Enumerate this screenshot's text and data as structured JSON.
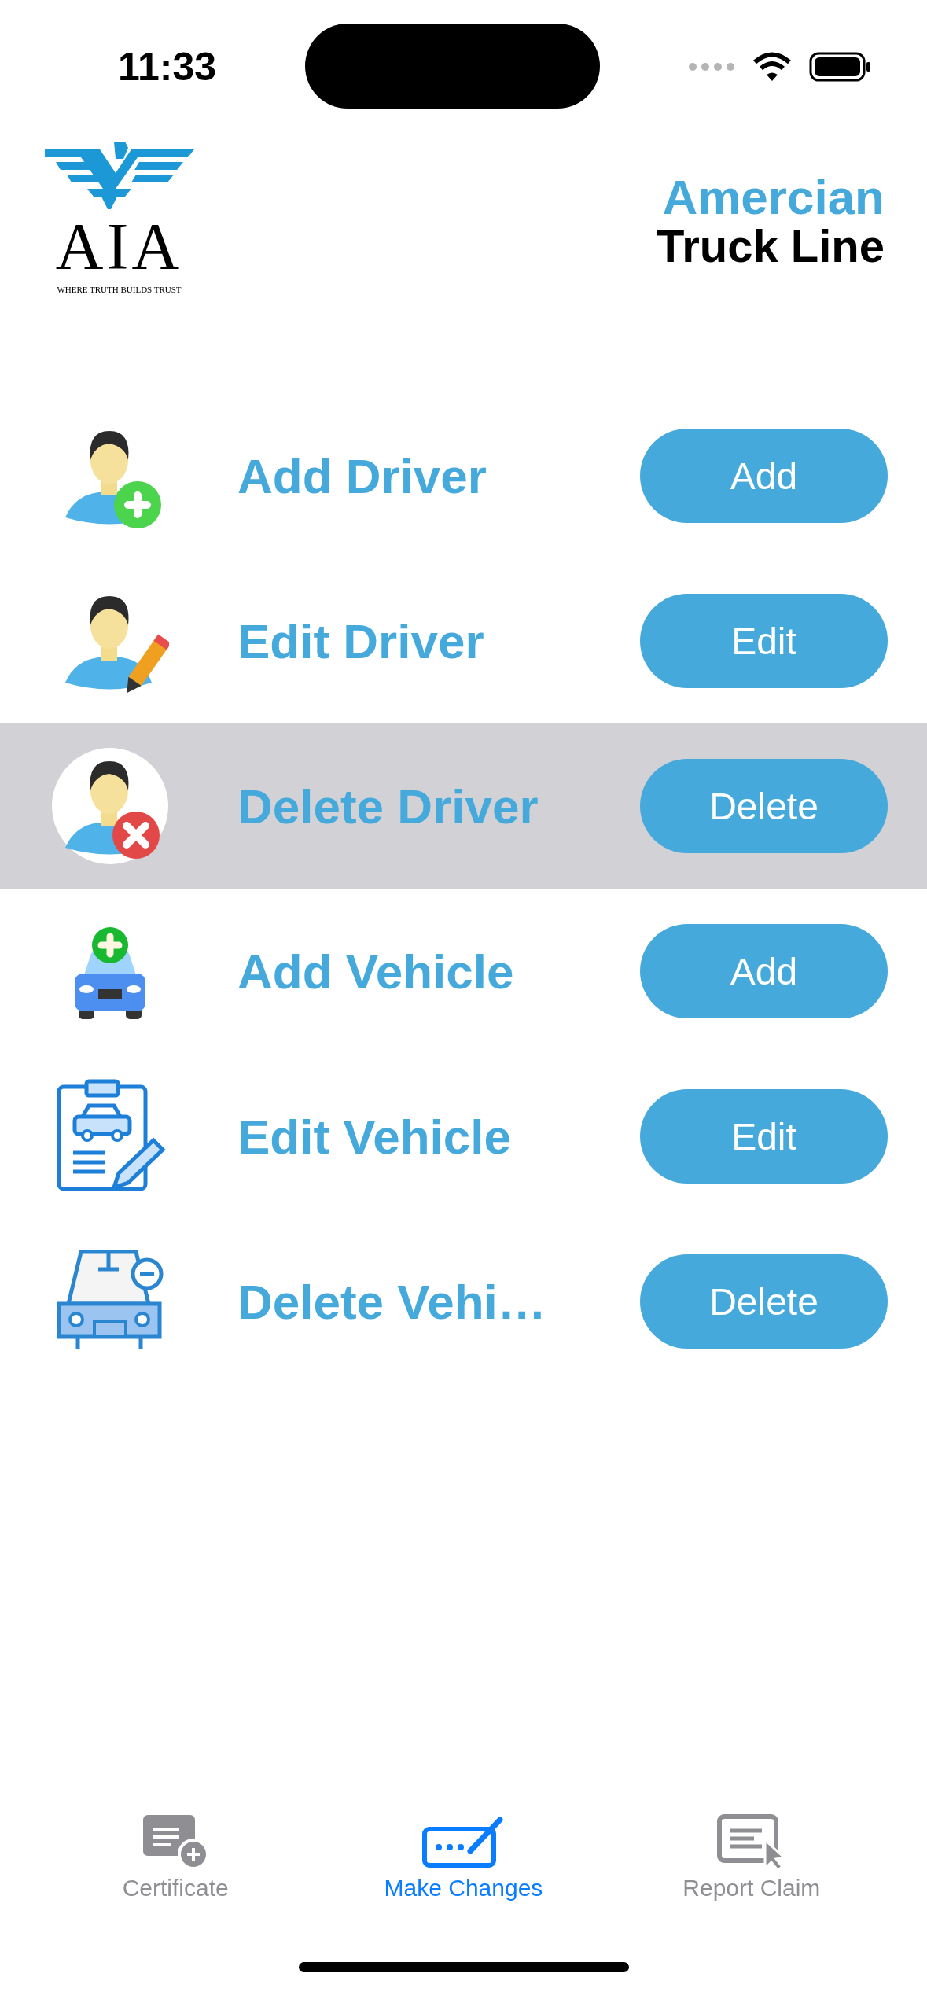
{
  "status_bar": {
    "time": "11:33"
  },
  "header": {
    "logo": {
      "letters": "AIA",
      "tagline": "WHERE TRUTH BUILDS TRUST"
    },
    "title_line_1": "Amercian",
    "title_line_2": "Truck Line"
  },
  "rows": [
    {
      "kind": "driver-add",
      "label": "Add Driver",
      "button": "Add",
      "selected": false
    },
    {
      "kind": "driver-edit",
      "label": "Edit Driver",
      "button": "Edit",
      "selected": false
    },
    {
      "kind": "driver-delete",
      "label": "Delete Driver",
      "button": "Delete",
      "selected": true
    },
    {
      "kind": "vehicle-add",
      "label": "Add Vehicle",
      "button": "Add",
      "selected": false
    },
    {
      "kind": "vehicle-edit",
      "label": "Edit Vehicle",
      "button": "Edit",
      "selected": false
    },
    {
      "kind": "vehicle-delete",
      "label": "Delete Vehi…",
      "button": "Delete",
      "selected": false
    }
  ],
  "tabs": [
    {
      "kind": "certificate",
      "label": "Certificate",
      "selected": false
    },
    {
      "kind": "changes",
      "label": "Make Changes",
      "selected": true
    },
    {
      "kind": "claim",
      "label": "Report Claim",
      "selected": false
    }
  ]
}
